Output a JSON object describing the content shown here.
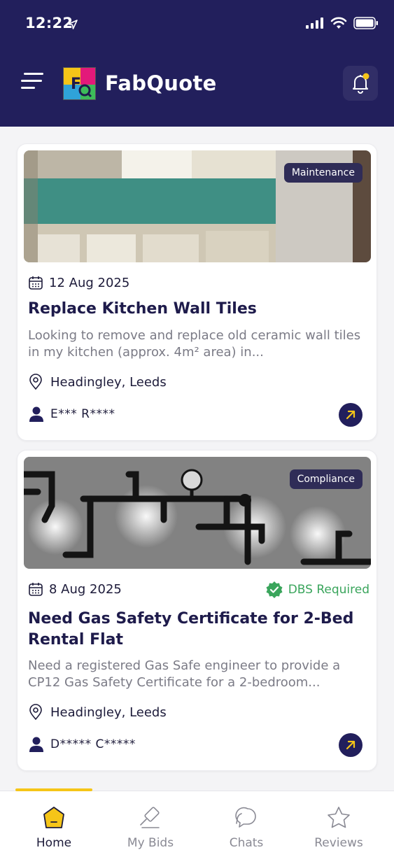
{
  "status_bar": {
    "time": "12:22"
  },
  "header": {
    "brand": "FabQuote"
  },
  "jobs": [
    {
      "tag": "Maintenance",
      "date": "12 Aug 2025",
      "title": "Replace Kitchen Wall Tiles",
      "description": "Looking to remove and replace old ceramic wall tiles in my kitchen (approx. 4m² area) in...",
      "location": "Headingley, Leeds",
      "user": "E*** R****"
    },
    {
      "tag": "Compliance",
      "date": "8 Aug 2025",
      "badge": "DBS Required",
      "title": "Need Gas Safety Certificate for 2-Bed Rental Flat",
      "description": "Need a registered Gas Safe engineer to provide a CP12 Gas Safety Certificate for a 2-bedroom...",
      "location": "Headingley, Leeds",
      "user": "D***** C*****"
    }
  ],
  "nav": {
    "items": [
      {
        "label": "Home",
        "icon": "home-icon",
        "active": true
      },
      {
        "label": "My Bids",
        "icon": "gavel-icon"
      },
      {
        "label": "Chats",
        "icon": "chat-icon"
      },
      {
        "label": "Reviews",
        "icon": "star-icon"
      }
    ]
  },
  "colors": {
    "primary": "#221f5c",
    "accent": "#f5c518",
    "success": "#3aa55c"
  }
}
